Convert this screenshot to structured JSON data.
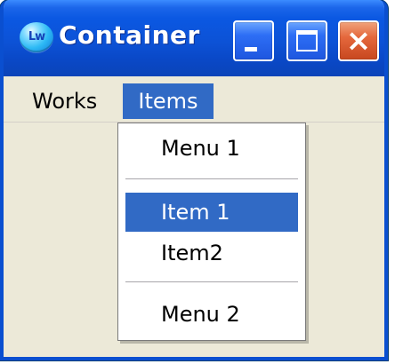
{
  "window": {
    "title": "Container",
    "icon_name": "labview-app-icon",
    "icon_text": "Lw",
    "controls": {
      "minimize": "minimize",
      "maximize": "maximize",
      "close": "×"
    }
  },
  "menubar": {
    "items": [
      {
        "label": "Works",
        "active": false
      },
      {
        "label": "Items",
        "active": true
      }
    ]
  },
  "dropdown": {
    "items": [
      {
        "label": "Menu 1",
        "selected": false
      },
      {
        "type": "separator"
      },
      {
        "label": "Item 1",
        "selected": true
      },
      {
        "label": "Item2",
        "selected": false
      },
      {
        "type": "separator"
      },
      {
        "label": "Menu 2",
        "selected": false
      }
    ]
  },
  "colors": {
    "titlebar_blue": "#0b58e2",
    "menu_highlight": "#316ac5",
    "window_face": "#ece9d8",
    "close_red": "#e5683d"
  }
}
